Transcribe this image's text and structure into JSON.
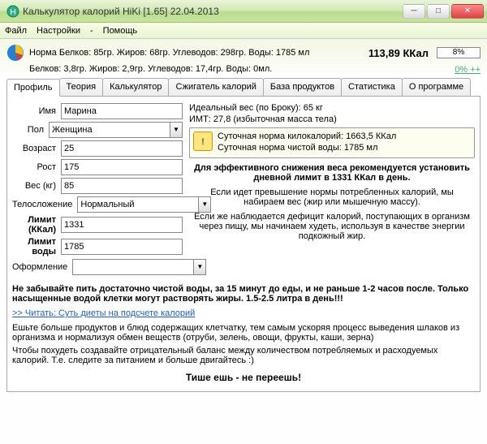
{
  "window": {
    "title": "Калькулятор калорий HiKi [1.65] 22.04.2013"
  },
  "menu": {
    "file": "Файл",
    "settings": "Настройки",
    "dash": "-",
    "help": "Помощь"
  },
  "summary": {
    "line1": "Норма Белков: 85гр. Жиров: 68гр. Углеводов: 298гр. Воды: 1785 мл",
    "line2": "Белков: 3,8гр. Жиров: 2,9гр. Углеводов: 17,4гр. Воды: 0мл.",
    "kcal": "113,89 ККал",
    "progress": "8%",
    "plus": "0% ++"
  },
  "tabs": {
    "profile": "Профиль",
    "theory": "Теория",
    "calc": "Калькулятор",
    "burner": "Сжигатель калорий",
    "products": "База продуктов",
    "stats": "Статистика",
    "about": "О программе"
  },
  "form": {
    "name_label": "Имя",
    "name": "Марина",
    "sex_label": "Пол",
    "sex": "Женщина",
    "age_label": "Возраст",
    "age": "25",
    "height_label": "Рост",
    "height": "175",
    "weight_label": "Вес (кг)",
    "weight": "85",
    "build_label": "Телосложение",
    "build": "Нормальный",
    "limit_label": "Лимит (ККал)",
    "limit": "1331",
    "water_label": "Лимит воды",
    "water": "1785",
    "skin_label": "Оформление"
  },
  "info": {
    "ideal": "Идеальный вес (по Броку): 65 кг",
    "bmi": "ИМТ: 27,8 (избыточная масса тела)",
    "daily_kcal": "Суточная норма килокалорий: 1663,5 ККал",
    "daily_water": "Суточная норма чистой воды: 1785 мл",
    "advice": "Для эффективного снижения веса рекомендуется установить дневной лимит в 1331 ККал в день.",
    "para1": "Если идет превышение нормы потребленных калорий, мы набираем вес (жир или мышечную массу).",
    "para2": "Если же наблюдается дефицит калорий, поступающих в организм через пищу, мы начинаем худеть, используя в качестве энергии подкожный жир."
  },
  "footer": {
    "water_note": "Не забывайте пить достаточно чистой воды, за 15 минут до еды, и не раньше 1-2 часов после. Только насыщенные водой клетки могут растворять жиры. 1.5-2.5 литра в день!!!",
    "link": ">>  Читать: Суть диеты на подсчете калорий",
    "fiber": "Ешьте больше продуктов и блюд содержащих клетчатку, тем самым ускоряя процесс выведения шлаков из организма и нормализуя обмен веществ (отруби, зелень, овощи, фрукты, каши, зерна)",
    "balance": "Чтобы похудеть создавайте отрицательный баланс между количеством потребляемых и расходуемых калорий. Т.е. следите за питанием и больше двигайтесь :)",
    "slogan": "Тише ешь - не переешь!"
  }
}
